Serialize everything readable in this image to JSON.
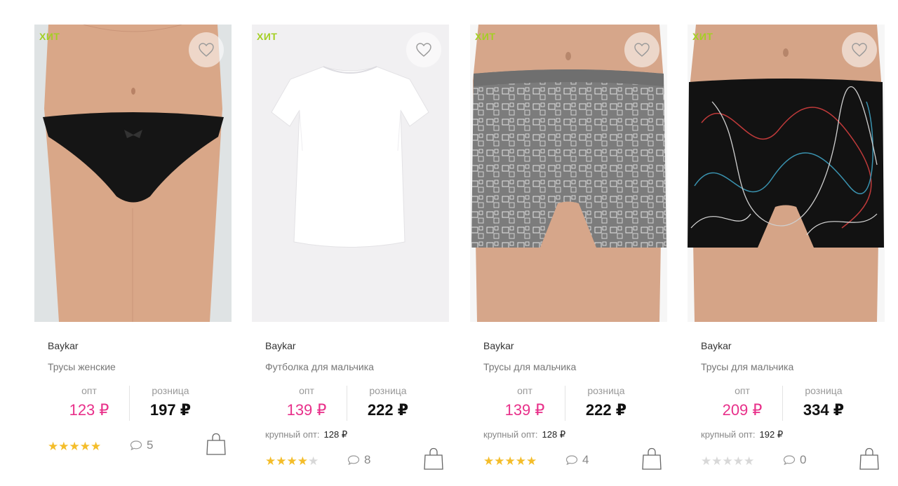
{
  "products": [
    {
      "badge": "ХИТ",
      "brand": "Baykar",
      "title": "Трусы женские",
      "opt_label": "опт",
      "opt_price": "123 ₽",
      "retail_label": "розница",
      "retail_price": "197 ₽",
      "bulk_label": "",
      "bulk_price": "",
      "rating": 5,
      "reviews": "5",
      "image": "women-briefs"
    },
    {
      "badge": "ХИТ",
      "brand": "Baykar",
      "title": "Футболка для мальчика",
      "opt_label": "опт",
      "opt_price": "139 ₽",
      "retail_label": "розница",
      "retail_price": "222 ₽",
      "bulk_label": "крупный опт:",
      "bulk_price": "128 ₽",
      "rating": 4,
      "reviews": "8",
      "image": "white-tshirt"
    },
    {
      "badge": "ХИТ",
      "brand": "Baykar",
      "title": "Трусы для мальчика",
      "opt_label": "опт",
      "opt_price": "139 ₽",
      "retail_label": "розница",
      "retail_price": "222 ₽",
      "bulk_label": "крупный опт:",
      "bulk_price": "128 ₽",
      "rating": 5,
      "reviews": "4",
      "image": "grey-boxers"
    },
    {
      "badge": "ХИТ",
      "brand": "Baykar",
      "title": "Трусы для мальчика",
      "opt_label": "опт",
      "opt_price": "209 ₽",
      "retail_label": "розница",
      "retail_price": "334 ₽",
      "bulk_label": "крупный опт:",
      "bulk_price": "192 ₽",
      "rating": 0,
      "reviews": "0",
      "image": "black-boxers"
    }
  ],
  "colors": {
    "badge": "#a4cf24",
    "opt_price": "#e8308a",
    "star_on": "#f4bd2a",
    "star_off": "#d8d8d8"
  },
  "icons": {
    "favorite": "heart-icon",
    "reviews": "comment-icon",
    "cart": "shopping-bag-icon",
    "rating": "star-icon"
  }
}
